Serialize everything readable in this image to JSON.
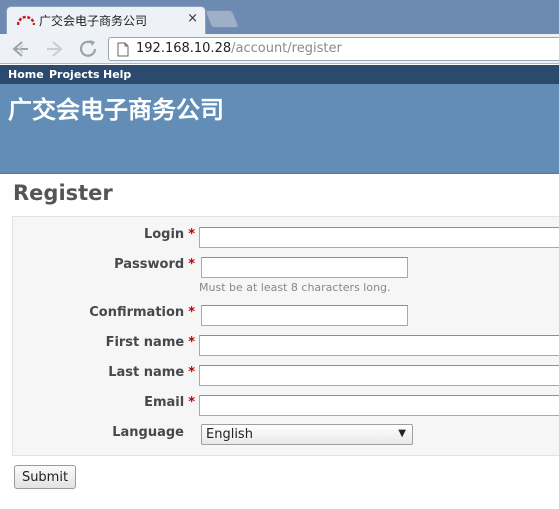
{
  "browser": {
    "tab_title": "广交会电子商务公司",
    "tab_close": "×",
    "url_host": "192.168.10.28",
    "url_path": "/account/register"
  },
  "top_menu": {
    "items": [
      {
        "label": "Home"
      },
      {
        "label": "Projects"
      },
      {
        "label": "Help"
      }
    ]
  },
  "header": {
    "title": "广交会电子商务公司"
  },
  "main": {
    "heading": "Register",
    "required_marker": "*",
    "fields": {
      "login": {
        "label": "Login",
        "value": "",
        "required": true
      },
      "password": {
        "label": "Password",
        "value": "",
        "required": true,
        "hint": "Must be at least 8 characters long."
      },
      "confirmation": {
        "label": "Confirmation",
        "value": "",
        "required": true
      },
      "first_name": {
        "label": "First name",
        "value": "",
        "required": true
      },
      "last_name": {
        "label": "Last name",
        "value": "",
        "required": true
      },
      "email": {
        "label": "Email",
        "value": "",
        "required": true
      },
      "language": {
        "label": "Language",
        "selected": "English",
        "arrow": "▼"
      }
    },
    "submit_label": "Submit"
  },
  "colors": {
    "tabstrip": "#6d8bb2",
    "top_menu": "#2c4a6e",
    "header": "#628db6",
    "required": "#bb0000"
  }
}
